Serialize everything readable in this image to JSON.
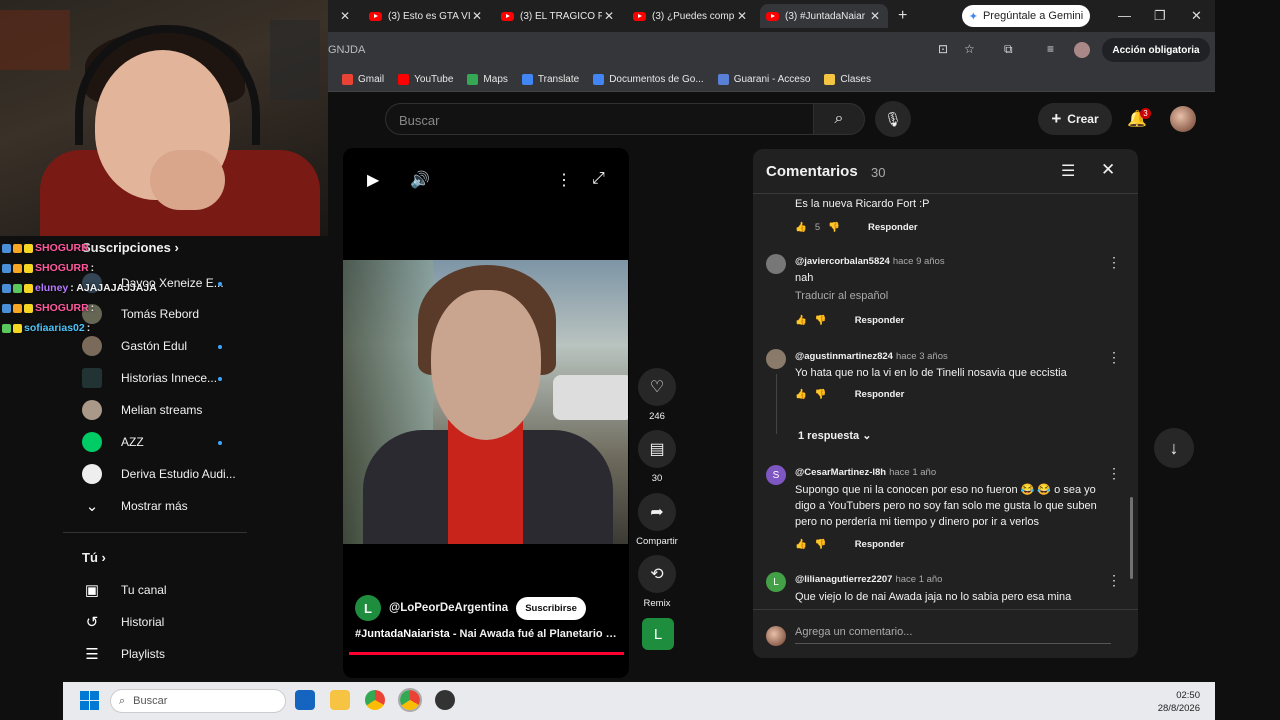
{
  "browser": {
    "tabs": [
      {
        "label": "(3) Esto es GTA VI"
      },
      {
        "label": "(3) EL TRAGICO FI"
      },
      {
        "label": "(3) ¿Puedes comp"
      },
      {
        "label": "(3) #JuntadaNaiar"
      }
    ],
    "gemini_label": "Pregúntale a Gemini",
    "url_fragment": "GNJDA",
    "action_required": "Acción obligatoria",
    "bookmarks": [
      "Gmail",
      "YouTube",
      "Maps",
      "Translate",
      "Documentos de Go...",
      "Guarani - Acceso",
      "Clases"
    ]
  },
  "youtube": {
    "search_placeholder": "Buscar",
    "create_label": "Crear",
    "notifications_count": "3"
  },
  "chat": [
    {
      "user": "SHOGURR",
      "message": ":",
      "color": "#ff5a9e"
    },
    {
      "user": "SHOGURR",
      "message": ":",
      "color": "#ff5a9e"
    },
    {
      "user": "eluney",
      "message": ": AJAJAJAJJAJA",
      "color": "#b57bff"
    },
    {
      "user": "SHOGURR",
      "message": ":",
      "color": "#ff5a9e"
    },
    {
      "user": "sofiaarias02",
      "message": ":",
      "color": "#4fc3f7"
    }
  ],
  "sidebar": {
    "subs_heading": "Suscripciones",
    "items": [
      {
        "label": "Davoo Xeneize E..."
      },
      {
        "label": "Tomás Rebord"
      },
      {
        "label": "Gastón Edul"
      },
      {
        "label": "Historias Innece..."
      },
      {
        "label": "Melian streams"
      },
      {
        "label": "AZZ"
      },
      {
        "label": "Deriva Estudio Audi..."
      }
    ],
    "show_more": "Mostrar más",
    "you_heading": "Tú",
    "you_items": [
      {
        "label": "Tu canal",
        "icon": "channel-icon"
      },
      {
        "label": "Historial",
        "icon": "history-icon"
      },
      {
        "label": "Playlists",
        "icon": "playlists-icon"
      }
    ]
  },
  "video": {
    "channel": "@LoPeorDeArgentina",
    "channel_initial": "L",
    "subscribe": "Suscribirse",
    "hashtag": "#JuntadaNaiarista",
    "title_rest": " - Nai Awada fué al Planetario a ..."
  },
  "actions": {
    "likes": "246",
    "comments": "30",
    "share": "Compartir",
    "remix": "Remix",
    "initial": "L"
  },
  "comments": {
    "title": "Comentarios",
    "count": "30",
    "items": [
      {
        "text": "Es la nueva Ricardo Fort :P",
        "likes": "5",
        "reply": "Responder"
      },
      {
        "user": "@javiercorbalan5824",
        "time": "hace 9 años",
        "text": "nah",
        "translate": "Traducir al español",
        "reply": "Responder"
      },
      {
        "user": "@agustinmartinez824",
        "time": "hace 3 años",
        "text": "Yo hata que no la vi en lo de Tinelli nosavia que eccistia",
        "reply": "Responder",
        "replies": "1 respuesta"
      },
      {
        "user": "@CesarMartinez-l8h",
        "time": "hace 1 año",
        "initial": "S",
        "text": "Supongo que ni la conocen por eso no fueron 😂 😂 o sea yo digo a YouTubers pero no soy fan solo me gusta lo que suben pero no perdería mi tiempo y dinero por ir a verlos",
        "reply": "Responder"
      },
      {
        "user": "@lilianagutierrez2207",
        "time": "hace 1 año",
        "initial": "L",
        "text": "Que viejo lo de nai Awada jaja no lo sabia pero esa mina deliraba"
      }
    ],
    "add_placeholder": "Agrega un comentario..."
  },
  "taskbar": {
    "search": "Buscar",
    "time": "02:50",
    "date": "28/8/2026"
  }
}
